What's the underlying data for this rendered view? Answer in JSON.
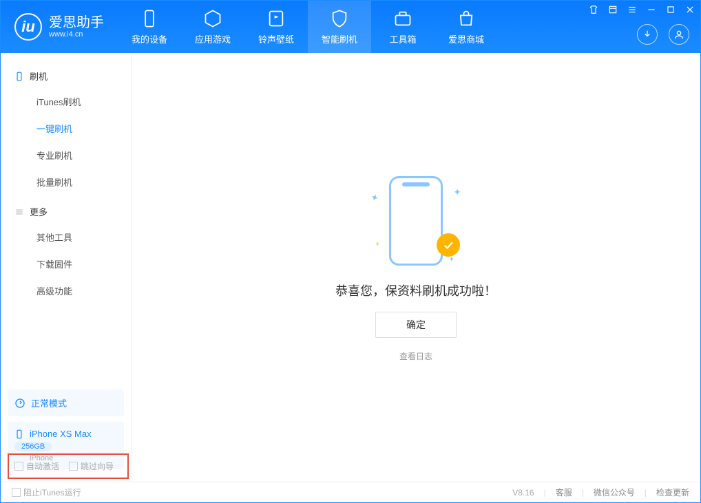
{
  "app": {
    "title": "爱思助手",
    "subtitle": "www.i4.cn"
  },
  "nav": {
    "items": [
      {
        "label": "我的设备"
      },
      {
        "label": "应用游戏"
      },
      {
        "label": "铃声壁纸"
      },
      {
        "label": "智能刷机"
      },
      {
        "label": "工具箱"
      },
      {
        "label": "爱思商城"
      }
    ]
  },
  "sidebar": {
    "section1": {
      "title": "刷机",
      "items": [
        "iTunes刷机",
        "一键刷机",
        "专业刷机",
        "批量刷机"
      ]
    },
    "section2": {
      "title": "更多",
      "items": [
        "其他工具",
        "下载固件",
        "高级功能"
      ]
    },
    "mode": "正常模式",
    "device": {
      "name": "iPhone XS Max",
      "storage": "256GB",
      "type": "iPhone"
    }
  },
  "main": {
    "message": "恭喜您，保资料刷机成功啦！",
    "ok": "确定",
    "view_log": "查看日志"
  },
  "options": {
    "auto_activate": "自动激活",
    "skip_guide": "跳过向导"
  },
  "statusbar": {
    "block_itunes": "阻止iTunes运行",
    "version": "V8.16",
    "links": [
      "客服",
      "微信公众号",
      "检查更新"
    ]
  }
}
